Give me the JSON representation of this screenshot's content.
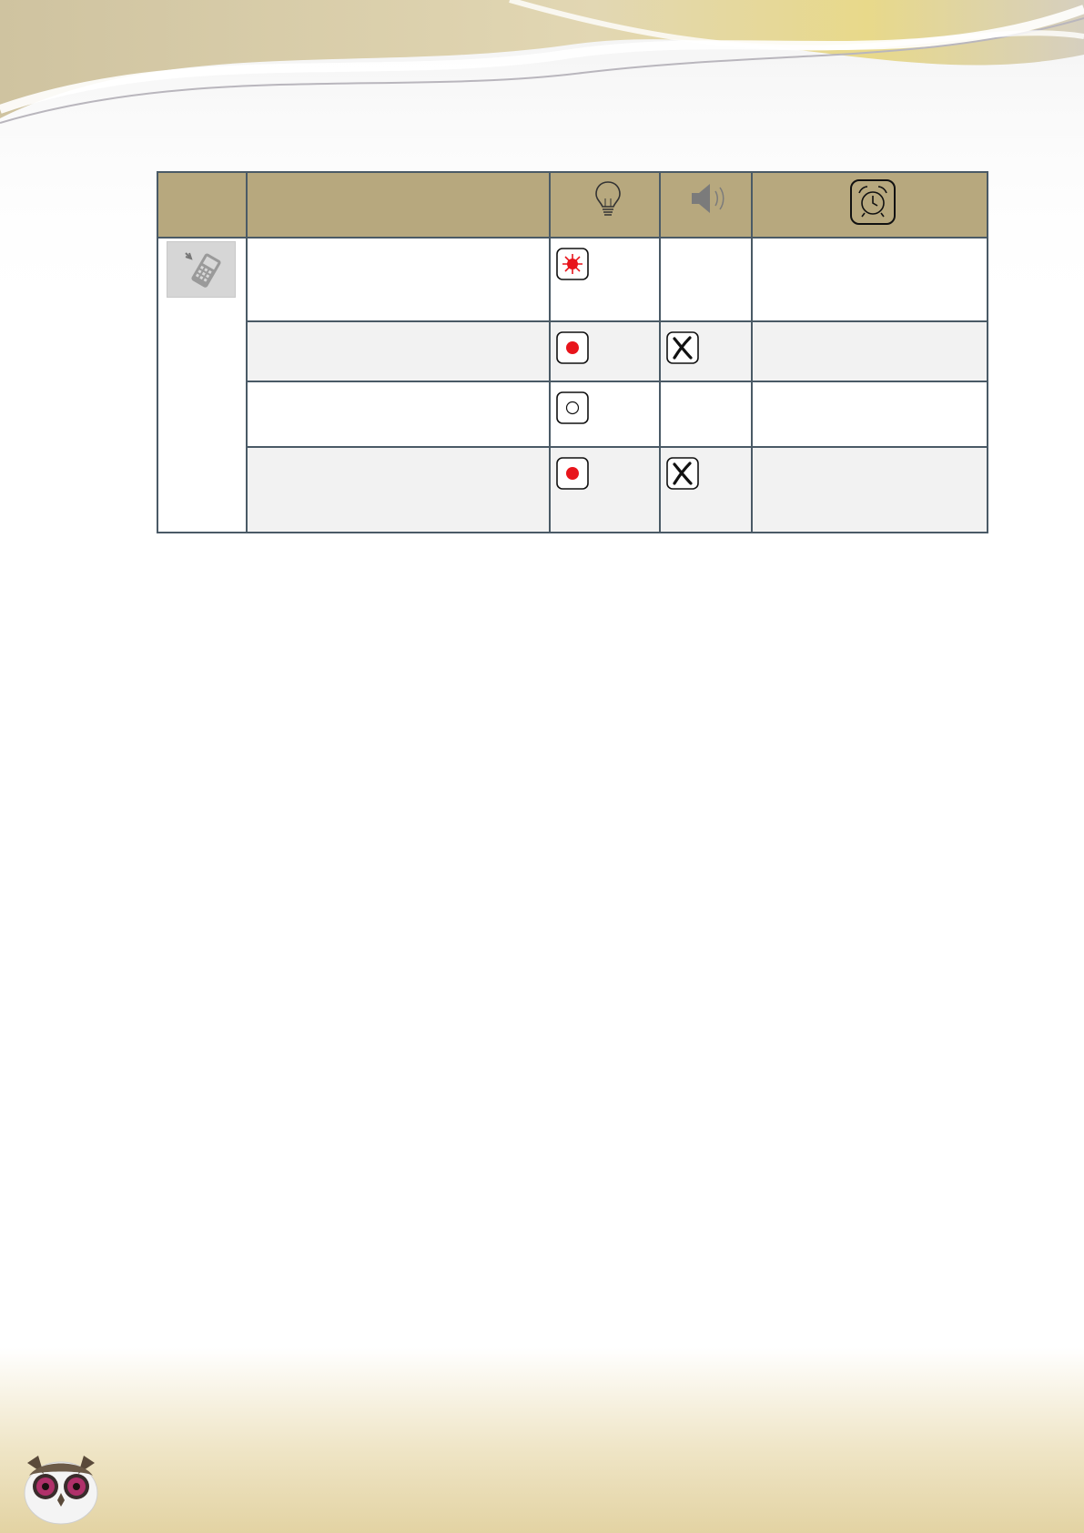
{
  "icons": {
    "header_light": "light-bulb-icon",
    "header_sound": "speaker-icon",
    "header_alarm": "alarm-clock-icon",
    "device": "mobile-phone-icon"
  },
  "colors": {
    "header_background": "#b7a87e",
    "row_alt_background": "#f2f2f2",
    "border": "#4a5a66",
    "indicator_red": "#e8141b"
  },
  "table": {
    "header": {
      "device": "",
      "description": "",
      "light": "",
      "sound": "",
      "alarm": ""
    },
    "rows": [
      {
        "description": "",
        "light": "flashing-red-icon",
        "sound": "",
        "alarm": ""
      },
      {
        "description": "",
        "light": "steady-red-icon",
        "sound": "x-mark-icon",
        "alarm": ""
      },
      {
        "description": "",
        "light": "off-light-icon",
        "sound": "",
        "alarm": ""
      },
      {
        "description": "",
        "light": "steady-red-icon",
        "sound": "x-mark-icon",
        "alarm": ""
      }
    ]
  }
}
